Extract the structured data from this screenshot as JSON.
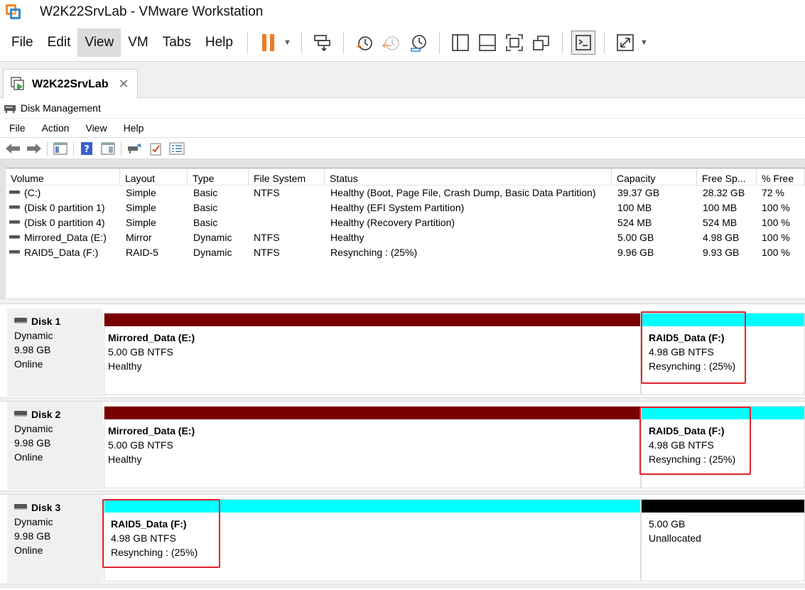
{
  "window": {
    "title": "W2K22SrvLab - VMware Workstation"
  },
  "vm_menu": [
    {
      "label": "File",
      "active": false
    },
    {
      "label": "Edit",
      "active": false
    },
    {
      "label": "View",
      "active": true
    },
    {
      "label": "VM",
      "active": false
    },
    {
      "label": "Tabs",
      "active": false
    },
    {
      "label": "Help",
      "active": false
    }
  ],
  "colors": {
    "accent_orange": "#f07a22",
    "dynamic_bar": "#7a0000",
    "raid5_bar": "#00ffff",
    "unallocated_bar": "#000000",
    "highlight": "#e0242f"
  },
  "vm_tab": {
    "label": "W2K22SrvLab"
  },
  "dm": {
    "title": "Disk Management",
    "menu": [
      "File",
      "Action",
      "View",
      "Help"
    ]
  },
  "volume_list": {
    "columns": [
      "Volume",
      "Layout",
      "Type",
      "File System",
      "Status",
      "Capacity",
      "Free Sp...",
      "% Free"
    ],
    "rows": [
      {
        "volume": "(C:)",
        "layout": "Simple",
        "type": "Basic",
        "fs": "NTFS",
        "status": "Healthy (Boot, Page File, Crash Dump, Basic Data Partition)",
        "capacity": "39.37 GB",
        "free": "28.32 GB",
        "pct": "72 %"
      },
      {
        "volume": "(Disk 0 partition 1)",
        "layout": "Simple",
        "type": "Basic",
        "fs": "",
        "status": "Healthy (EFI System Partition)",
        "capacity": "100 MB",
        "free": "100 MB",
        "pct": "100 %"
      },
      {
        "volume": "(Disk 0 partition 4)",
        "layout": "Simple",
        "type": "Basic",
        "fs": "",
        "status": "Healthy (Recovery Partition)",
        "capacity": "524 MB",
        "free": "524 MB",
        "pct": "100 %"
      },
      {
        "volume": "Mirrored_Data (E:)",
        "layout": "Mirror",
        "type": "Dynamic",
        "fs": "NTFS",
        "status": "Healthy",
        "capacity": "5.00 GB",
        "free": "4.98 GB",
        "pct": "100 %"
      },
      {
        "volume": "RAID5_Data (F:)",
        "layout": "RAID-5",
        "type": "Dynamic",
        "fs": "NTFS",
        "status": "Resynching : (25%)",
        "capacity": "9.96 GB",
        "free": "9.93 GB",
        "pct": "100 %"
      }
    ]
  },
  "disks": [
    {
      "name": "Disk 1",
      "type": "Dynamic",
      "size": "9.98 GB",
      "status": "Online",
      "partitions": [
        {
          "name": "Mirrored_Data  (E:)",
          "detail": "5.00 GB NTFS",
          "state": "Healthy",
          "bar": "dynamic"
        },
        {
          "name": "RAID5_Data  (F:)",
          "detail": "4.98 GB NTFS",
          "state": "Resynching : (25%)",
          "bar": "raid5",
          "highlighted": true
        }
      ]
    },
    {
      "name": "Disk 2",
      "type": "Dynamic",
      "size": "9.98 GB",
      "status": "Online",
      "partitions": [
        {
          "name": "Mirrored_Data  (E:)",
          "detail": "5.00 GB NTFS",
          "state": "Healthy",
          "bar": "dynamic"
        },
        {
          "name": "RAID5_Data  (F:)",
          "detail": "4.98 GB NTFS",
          "state": "Resynching : (25%)",
          "bar": "raid5",
          "highlighted": true
        }
      ]
    },
    {
      "name": "Disk 3",
      "type": "Dynamic",
      "size": "9.98 GB",
      "status": "Online",
      "partitions": [
        {
          "name": "RAID5_Data  (F:)",
          "detail": "4.98 GB NTFS",
          "state": "Resynching : (25%)",
          "bar": "raid5",
          "highlighted": true
        },
        {
          "name": "",
          "detail": "5.00 GB",
          "state": "Unallocated",
          "bar": "unallocated"
        }
      ]
    }
  ]
}
